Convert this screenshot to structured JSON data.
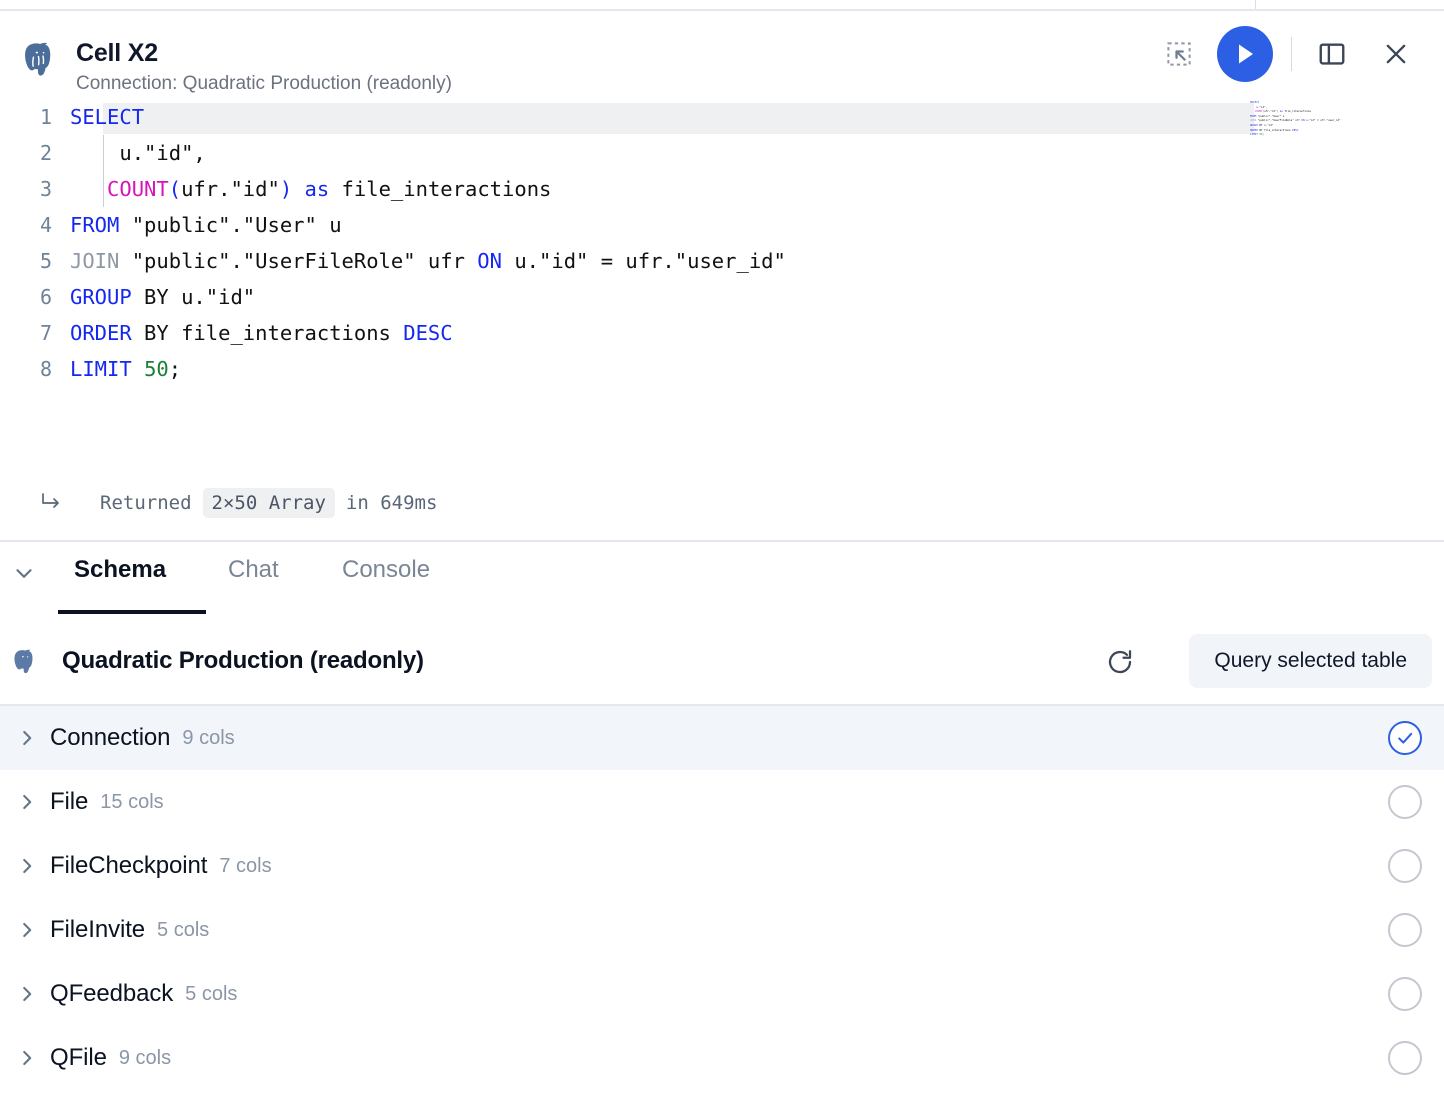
{
  "cell": {
    "title": "Cell X2",
    "subtitle": "Connection: Quadratic Production (readonly)",
    "db_icon": "postgresql-elephant-icon",
    "actions": {
      "select_range": "select-range-icon",
      "run": "run-query-button",
      "panel": "toggle-panel-icon",
      "close": "close-icon"
    }
  },
  "editor": {
    "language": "sql",
    "active_line": 1,
    "lines": [
      {
        "n": "1",
        "tokens": [
          {
            "t": "SELECT",
            "c": "kw"
          }
        ]
      },
      {
        "n": "2",
        "tokens": [
          {
            "t": "    u.\"id\",",
            "c": "plain"
          }
        ]
      },
      {
        "n": "3",
        "tokens": [
          {
            "t": "   ",
            "c": "plain"
          },
          {
            "t": "COUNT",
            "c": "fn"
          },
          {
            "t": "(",
            "c": "op"
          },
          {
            "t": "ufr.\"id\"",
            "c": "plain"
          },
          {
            "t": ")",
            "c": "op"
          },
          {
            "t": " ",
            "c": "plain"
          },
          {
            "t": "as",
            "c": "kw"
          },
          {
            "t": " file_interactions",
            "c": "plain"
          }
        ]
      },
      {
        "n": "4",
        "tokens": [
          {
            "t": "FROM",
            "c": "kw"
          },
          {
            "t": " \"public\".\"User\" u",
            "c": "plain"
          }
        ]
      },
      {
        "n": "5",
        "tokens": [
          {
            "t": "JOIN",
            "c": "kwd"
          },
          {
            "t": " \"public\".\"UserFileRole\" ufr ",
            "c": "plain"
          },
          {
            "t": "ON",
            "c": "kw"
          },
          {
            "t": " u.\"id\" = ufr.\"user_id\"",
            "c": "plain"
          }
        ]
      },
      {
        "n": "6",
        "tokens": [
          {
            "t": "GROUP",
            "c": "kw"
          },
          {
            "t": " BY u.\"id\"",
            "c": "plain"
          }
        ]
      },
      {
        "n": "7",
        "tokens": [
          {
            "t": "ORDER",
            "c": "kw"
          },
          {
            "t": " BY file_interactions ",
            "c": "plain"
          },
          {
            "t": "DESC",
            "c": "kw"
          }
        ]
      },
      {
        "n": "8",
        "tokens": [
          {
            "t": "LIMIT",
            "c": "kw"
          },
          {
            "t": " ",
            "c": "plain"
          },
          {
            "t": "50",
            "c": "num"
          },
          {
            "t": ";",
            "c": "plain"
          }
        ]
      }
    ],
    "minimap": "minimap-overview"
  },
  "result": {
    "arrow_icon": "return-arrow-icon",
    "label": "Returned",
    "shape": "2×50 Array",
    "timing": "in 649ms"
  },
  "panel": {
    "collapse_icon": "chevron-down-icon",
    "tabs": [
      {
        "label": "Schema",
        "active": true
      },
      {
        "label": "Chat",
        "active": false
      },
      {
        "label": "Console",
        "active": false
      }
    ]
  },
  "connection": {
    "icon": "postgresql-elephant-icon",
    "name": "Quadratic Production (readonly)",
    "refresh_icon": "refresh-icon",
    "query_button": "Query selected table"
  },
  "schema": {
    "tables": [
      {
        "name": "Connection",
        "cols": "9 cols",
        "selected": true
      },
      {
        "name": "File",
        "cols": "15 cols",
        "selected": false
      },
      {
        "name": "FileCheckpoint",
        "cols": "7 cols",
        "selected": false
      },
      {
        "name": "FileInvite",
        "cols": "5 cols",
        "selected": false
      },
      {
        "name": "QFeedback",
        "cols": "5 cols",
        "selected": false
      },
      {
        "name": "QFile",
        "cols": "9 cols",
        "selected": false
      }
    ]
  },
  "colors": {
    "accent": "#2c5fe4",
    "selected_row": "#f2f5fa",
    "keyword": "#1528f0",
    "function": "#d714b8",
    "number": "#1a7f37",
    "muted": "#8b96a6"
  }
}
